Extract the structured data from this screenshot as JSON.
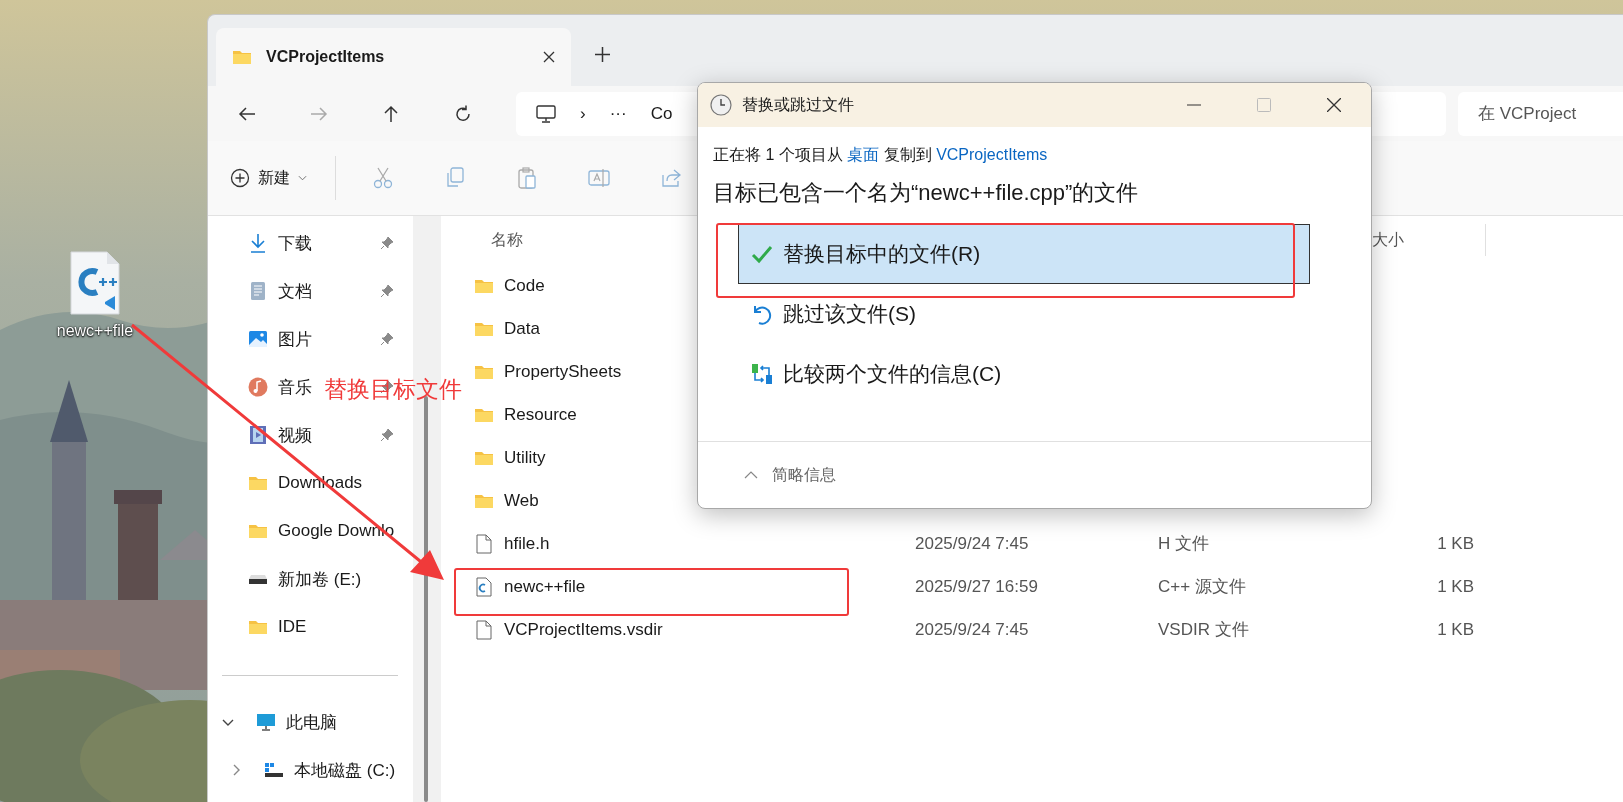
{
  "desktop": {
    "icon": {
      "label": "newc++file"
    }
  },
  "explorer": {
    "tab": {
      "title": "VCProjectItems"
    },
    "address": {
      "separator": "›",
      "overflow": "···",
      "crumb": "Co"
    },
    "search": {
      "placeholder": "在 VCProject"
    },
    "toolbar": {
      "new_label": "新建"
    },
    "sidebar": {
      "quick_access": [
        {
          "kind": "download",
          "label": "下载",
          "pinned": true
        },
        {
          "kind": "document",
          "label": "文档",
          "pinned": true
        },
        {
          "kind": "picture",
          "label": "图片",
          "pinned": true
        },
        {
          "kind": "music",
          "label": "音乐",
          "pinned": true
        },
        {
          "kind": "video",
          "label": "视频",
          "pinned": true
        },
        {
          "kind": "folder",
          "label": "Downloads",
          "pinned": false
        },
        {
          "kind": "folder",
          "label": "Google Downlo",
          "pinned": false
        },
        {
          "kind": "drive",
          "label": "新加卷 (E:)",
          "pinned": false
        },
        {
          "kind": "folder",
          "label": "IDE",
          "pinned": false
        }
      ],
      "tree": [
        {
          "label": "此电脑",
          "expanded": true,
          "children": [
            {
              "label": "本地磁盘 (C:)",
              "expanded": false
            }
          ]
        }
      ]
    },
    "file_list": {
      "columns": {
        "name": "名称",
        "size": "大小"
      },
      "rows": [
        {
          "kind": "folder",
          "name": "Code"
        },
        {
          "kind": "folder",
          "name": "Data"
        },
        {
          "kind": "folder",
          "name": "PropertySheets"
        },
        {
          "kind": "folder",
          "name": "Resource"
        },
        {
          "kind": "folder",
          "name": "Utility"
        },
        {
          "kind": "folder",
          "name": "Web"
        },
        {
          "kind": "file",
          "name": "hfile.h",
          "date": "2025/9/24 7:45",
          "type": "H 文件",
          "size": "1 KB"
        },
        {
          "kind": "cpp",
          "name": "newc++file",
          "date": "2025/9/27 16:59",
          "type": "C++ 源文件",
          "size": "1 KB"
        },
        {
          "kind": "file",
          "name": "VCProjectItems.vsdir",
          "date": "2025/9/24 7:45",
          "type": "VSDIR 文件",
          "size": "1 KB"
        }
      ]
    }
  },
  "dialog": {
    "title": "替换或跳过文件",
    "status": {
      "prefix": "正在将 1 个项目从 ",
      "source": "桌面",
      "middle": " 复制到 ",
      "destination": "VCProjectItems"
    },
    "message": "目标已包含一个名为“newc++file.cpp”的文件",
    "options": [
      {
        "kind": "replace",
        "label": "替换目标中的文件(R)",
        "selected": true
      },
      {
        "kind": "skip",
        "label": "跳过该文件(S)",
        "selected": false
      },
      {
        "kind": "compare",
        "label": "比较两个文件的信息(C)",
        "selected": false
      }
    ],
    "details_toggle": "简略信息"
  },
  "annotation": {
    "text": "替换目标文件"
  }
}
